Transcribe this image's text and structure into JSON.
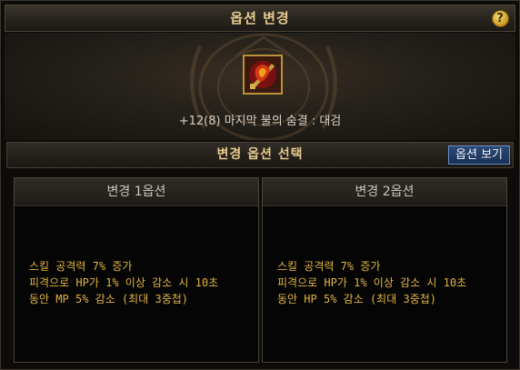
{
  "window": {
    "title": "옵션 변경",
    "help_label": "?"
  },
  "item": {
    "name": "+12(8) 마지막 불의 숨결 : 대검",
    "icon": "flame-sword-item-icon"
  },
  "section": {
    "title": "변경 옵션 선택",
    "view_button_label": "옵션 보기"
  },
  "options": [
    {
      "title": "변경 1옵션",
      "lines": [
        "스킬 공격력 7% 증가",
        "피격으로 HP가 1% 이상 감소 시 10초",
        "동안 MP 5% 감소 (최대 3중첩)"
      ]
    },
    {
      "title": "변경 2옵션",
      "lines": [
        "스킬 공격력 7% 증가",
        "피격으로 HP가 1% 이상 감소 시 10초",
        "동안 HP 5% 감소 (최대 3중첩)"
      ]
    }
  ],
  "colors": {
    "title_text": "#e6c98d",
    "option_text": "#e0b440",
    "button_blue": "#2b4a78"
  }
}
